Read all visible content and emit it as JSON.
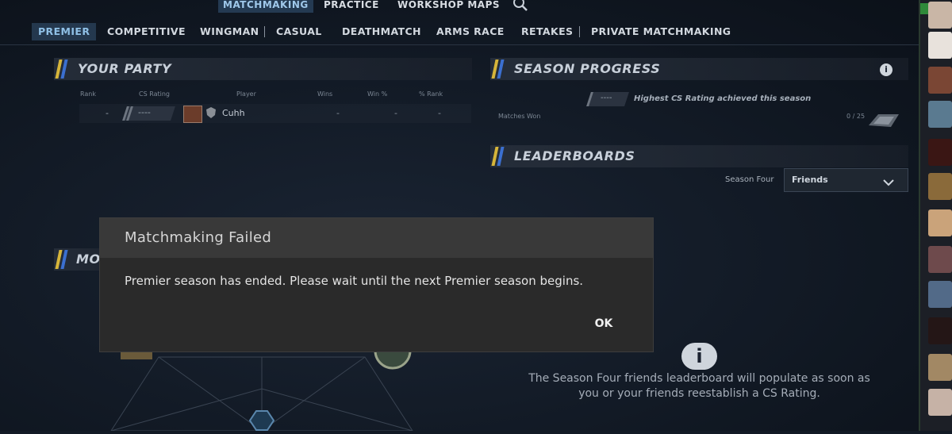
{
  "top_nav": [
    {
      "label": "MATCHMAKING",
      "active": true
    },
    {
      "label": "PRACTICE",
      "active": false
    },
    {
      "label": "WORKSHOP MAPS",
      "active": false
    }
  ],
  "sub_nav": [
    {
      "label": "PREMIER",
      "active": true
    },
    {
      "label": "COMPETITIVE",
      "active": false
    },
    {
      "label": "WINGMAN",
      "active": false
    },
    {
      "label": "CASUAL",
      "active": false
    },
    {
      "label": "DEATHMATCH",
      "active": false
    },
    {
      "label": "ARMS RACE",
      "active": false
    },
    {
      "label": "RETAKES",
      "active": false
    },
    {
      "label": "PRIVATE MATCHMAKING",
      "active": false
    }
  ],
  "party": {
    "title": "YOUR PARTY",
    "columns": [
      "Rank",
      "CS Rating",
      "Player",
      "Wins",
      "Win %",
      "% Rank"
    ],
    "row": {
      "rank": "-",
      "rating": "----",
      "player": "Cuhh",
      "wins": "-",
      "win_pct": "-",
      "pct_rank": "-"
    }
  },
  "season": {
    "title": "SEASON PROGRESS",
    "rating_placeholder": "----",
    "highest_label": "Highest CS Rating achieved this season",
    "matches_won_label": "Matches Won",
    "matches_won_value": "0 / 25"
  },
  "leaderboards": {
    "title": "LEADERBOARDS",
    "season_label": "Season Four",
    "dropdown_value": "Friends",
    "info_text_line1": "The Season Four friends leaderboard will populate as soon as",
    "info_text_line2": "you or your friends reestablish a CS Rating."
  },
  "maps_panel": {
    "title_visible": "MO"
  },
  "dialog": {
    "title": "Matchmaking Failed",
    "message": "Premier season has ended. Please wait until the next Premier season begins.",
    "ok_label": "OK"
  },
  "icons": {
    "info": "info-icon",
    "search": "search-icon",
    "chevron": "chevron-down-icon"
  },
  "colors": {
    "accent_blue": "#3b6fd0",
    "accent_gold": "#d6b53a",
    "dialog_bg": "#2a2a2a"
  }
}
